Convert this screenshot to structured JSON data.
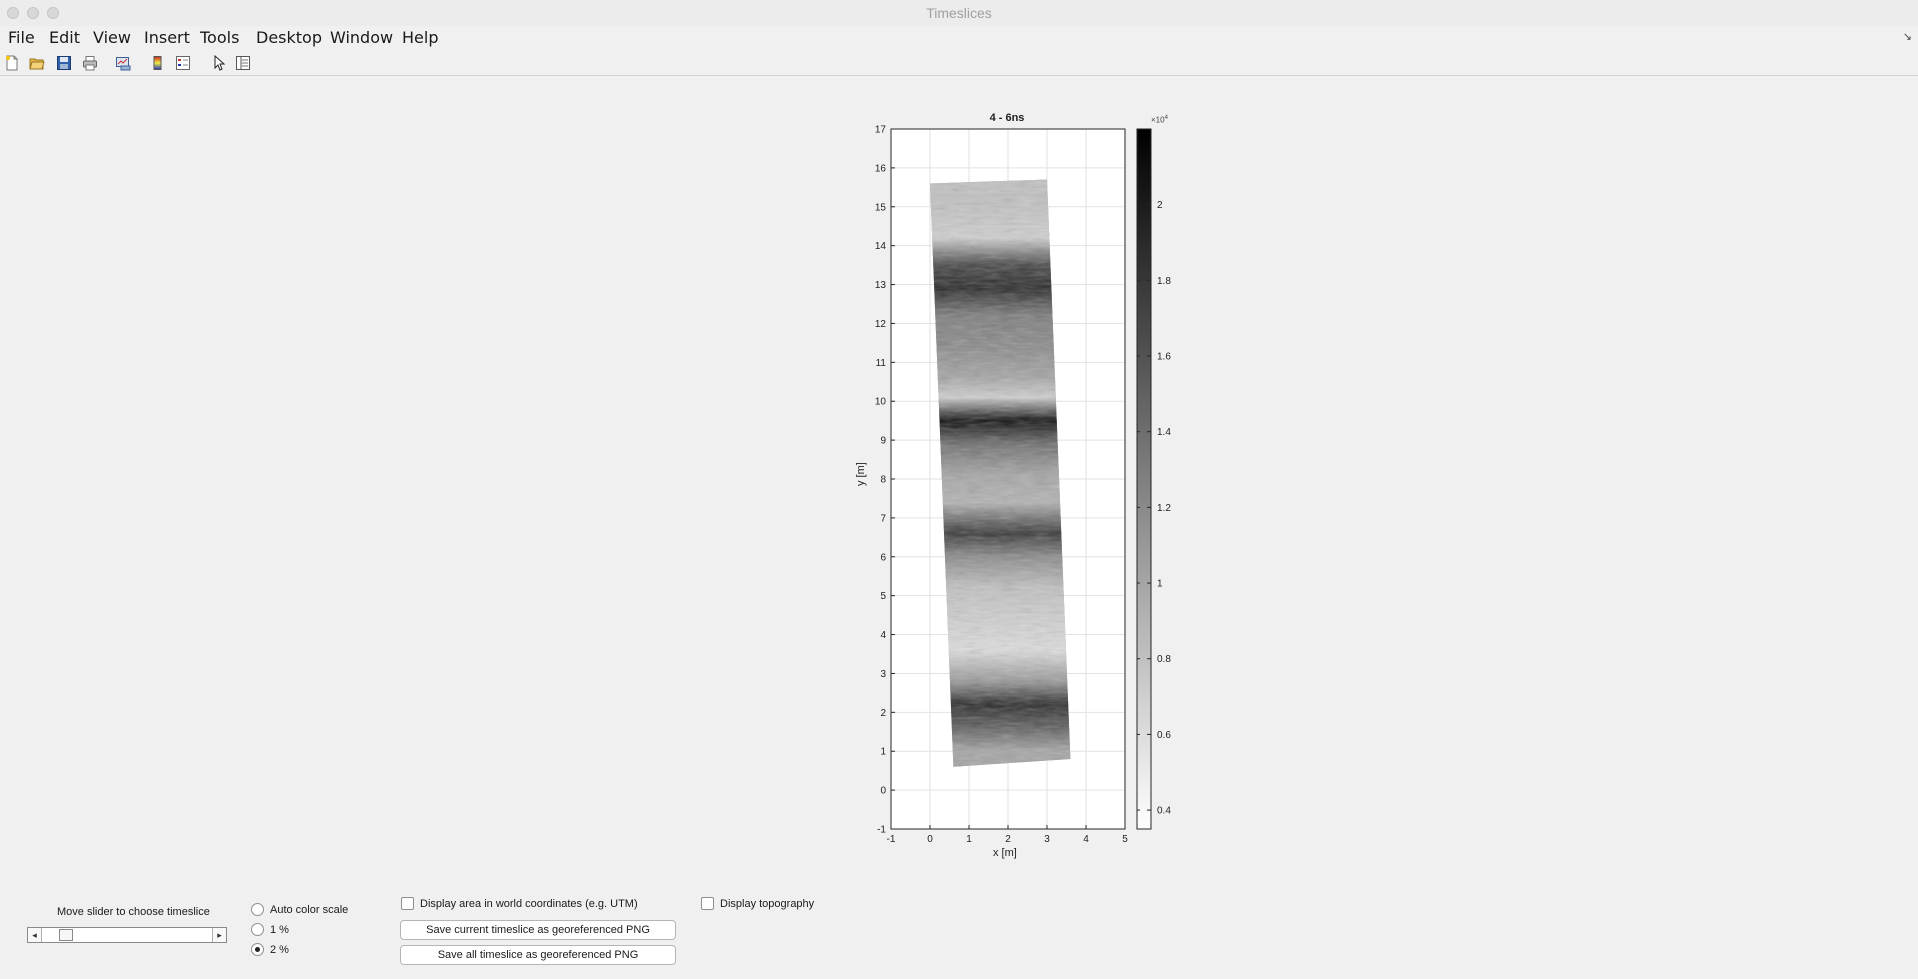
{
  "window": {
    "title": "Timeslices"
  },
  "menubar": {
    "items": [
      "File",
      "Edit",
      "View",
      "Insert",
      "Tools",
      "Desktop",
      "Window",
      "Help"
    ]
  },
  "toolbar": {
    "icons": [
      "new-figure-icon",
      "open-file-icon",
      "save-icon",
      "print-icon",
      "link-plot-icon",
      "colorbar-icon",
      "legend-icon",
      "edit-plot-icon",
      "property-inspector-icon"
    ]
  },
  "figure": {
    "title": "4 - 6ns",
    "xlabel": "x [m]",
    "ylabel": "y [m]",
    "colorbar_exponent": "×10",
    "colorbar_exponent_power": "4"
  },
  "chart_data": {
    "type": "heatmap",
    "title": "4 - 6ns",
    "xlabel": "x [m]",
    "ylabel": "y [m]",
    "xlim": [
      -1,
      5
    ],
    "ylim": [
      -1,
      17
    ],
    "xticks": [
      "-1",
      "0",
      "1",
      "2",
      "3",
      "4",
      "5"
    ],
    "yticks": [
      "-1",
      "0",
      "1",
      "2",
      "3",
      "4",
      "5",
      "6",
      "7",
      "8",
      "9",
      "10",
      "11",
      "12",
      "13",
      "14",
      "15",
      "16",
      "17"
    ],
    "grid": true,
    "colormap": "gray (reversed: high values dark)",
    "colorbar": {
      "ticks": [
        "0.4",
        "0.6",
        "0.8",
        "1",
        "1.2",
        "1.4",
        "1.6",
        "1.8",
        "2"
      ],
      "multiplier": "×10^4",
      "range": [
        0.35,
        2.2
      ]
    },
    "data_extent": {
      "corners": [
        [
          0.0,
          15.6
        ],
        [
          3.0,
          15.7
        ],
        [
          3.6,
          0.8
        ],
        [
          0.6,
          0.6
        ]
      ]
    },
    "intensity_bands": [
      {
        "y": 15.1,
        "level": 0.8
      },
      {
        "y": 14.2,
        "level": 0.7
      },
      {
        "y": 13.5,
        "level": 1.7
      },
      {
        "y": 12.9,
        "level": 1.9
      },
      {
        "y": 12.2,
        "level": 1.3
      },
      {
        "y": 11.4,
        "level": 1.2
      },
      {
        "y": 10.6,
        "level": 1.0
      },
      {
        "y": 10.1,
        "level": 0.7
      },
      {
        "y": 9.5,
        "level": 2.1
      },
      {
        "y": 8.9,
        "level": 1.4
      },
      {
        "y": 8.1,
        "level": 1.0
      },
      {
        "y": 7.4,
        "level": 0.9
      },
      {
        "y": 6.6,
        "level": 1.8
      },
      {
        "y": 6.0,
        "level": 1.2
      },
      {
        "y": 5.2,
        "level": 0.8
      },
      {
        "y": 4.4,
        "level": 0.7
      },
      {
        "y": 3.6,
        "level": 0.6
      },
      {
        "y": 2.8,
        "level": 1.1
      },
      {
        "y": 2.2,
        "level": 1.9
      },
      {
        "y": 1.6,
        "level": 1.5
      },
      {
        "y": 1.0,
        "level": 1.0
      }
    ]
  },
  "controls": {
    "slider_label": "Move slider to choose timeslice",
    "slider_value": 0.1,
    "radio_auto": "Auto color scale",
    "radio_1": "1 %",
    "radio_2": "2 %",
    "radio_selected": "2 %",
    "check_world": "Display area in world coordinates (e.g. UTM)",
    "check_topo": "Display topography",
    "btn_save_current": "Save current timeslice as georeferenced PNG",
    "btn_save_all": "Save all timeslice as georeferenced PNG"
  }
}
